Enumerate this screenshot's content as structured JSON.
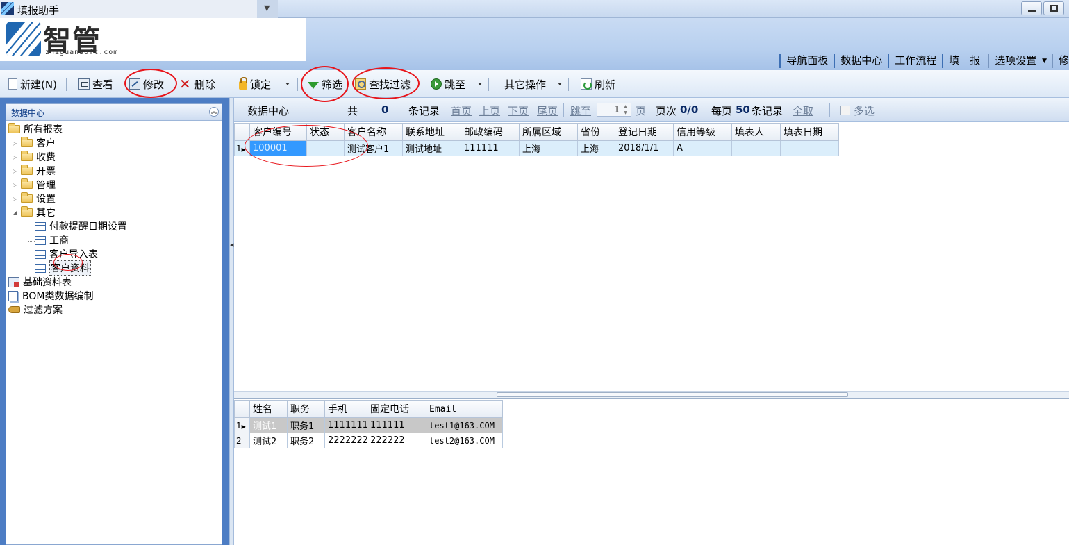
{
  "window": {
    "title": "填报助手"
  },
  "brand": {
    "logo_text": "智管",
    "logo_sub": "zhiguansoft.com"
  },
  "topnav": {
    "items": [
      "导航面板",
      "数据中心",
      "工作流程",
      "填　报",
      "选项设置",
      "修"
    ]
  },
  "toolbar": {
    "new_label": "新建(N)",
    "view_label": "查看",
    "edit_label": "修改",
    "delete_label": "删除",
    "lock_label": "锁定",
    "filter_label": "筛选",
    "find_filter_label": "查找过滤",
    "goto_label": "跳至",
    "other_label": "其它操作",
    "refresh_label": "刷新"
  },
  "sidebar": {
    "title": "数据中心",
    "root": "所有报表",
    "folders": [
      "客户",
      "收费",
      "开票",
      "管理",
      "设置",
      "其它"
    ],
    "other_children": [
      "付款提醒日期设置",
      "工商",
      "客户导入表",
      "客户资料"
    ],
    "extra": [
      "基础资料表",
      "BOM类数据编制",
      "过滤方案"
    ]
  },
  "pager": {
    "section": "数据中心",
    "total_prefix": "共",
    "total_count": "0",
    "total_suffix": "条记录",
    "first": "首页",
    "prev": "上页",
    "next": "下页",
    "last": "尾页",
    "jump": "跳至",
    "page_value": "1",
    "page_unit": "页",
    "page_info_label": "页次",
    "page_info": "0/0",
    "per_page_label": "每页",
    "per_page": "50",
    "per_page_suffix": "条记录",
    "all": "全取",
    "multi": "多选"
  },
  "main_grid": {
    "columns": [
      "客户编号",
      "状态",
      "客户名称",
      "联系地址",
      "邮政编码",
      "所属区域",
      "省份",
      "登记日期",
      "信用等级",
      "填表人",
      "填表日期"
    ],
    "rows": [
      {
        "row_no": "1",
        "cells": [
          "100001",
          "",
          "测试客户1",
          "测试地址",
          "111111",
          "上海",
          "上海",
          "2018/1/1",
          "A",
          "",
          ""
        ]
      }
    ]
  },
  "detail_grid": {
    "columns": [
      "姓名",
      "职务",
      "手机",
      "固定电话",
      "Email"
    ],
    "rows": [
      {
        "row_no": "1",
        "cells": [
          "测试1",
          "职务1",
          "1111111",
          "111111",
          "test1@163.COM"
        ]
      },
      {
        "row_no": "2",
        "cells": [
          "测试2",
          "职务2",
          "2222222",
          "222222",
          "test2@163.COM"
        ]
      }
    ]
  },
  "colors": {
    "accent": "#3399ff",
    "panel_blue": "#4d7dc4",
    "annotation_red": "#e8151b"
  }
}
